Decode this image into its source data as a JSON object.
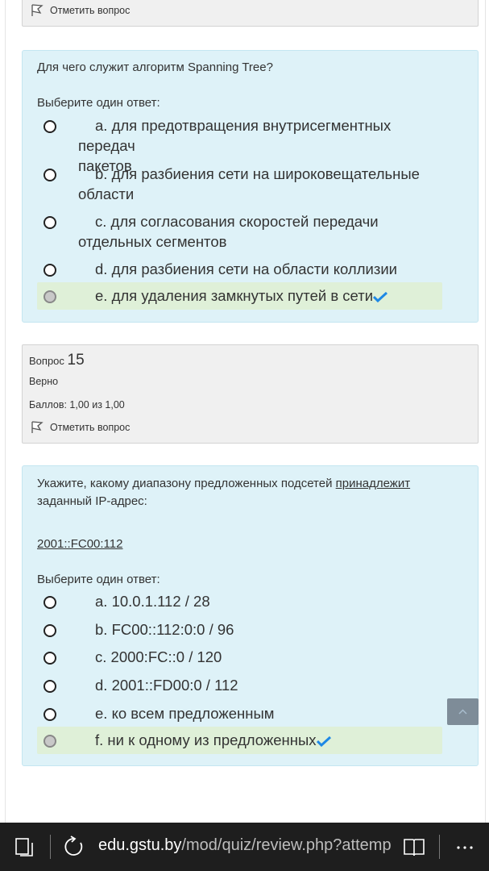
{
  "top_box": {
    "flag_label": "Отметить вопрос"
  },
  "question14": {
    "text": "Для чего служит алгоритм Spanning Tree?",
    "prompt": "Выберите один ответ:",
    "answers": [
      {
        "line1": "a. для предотвращения внутрисегментных передач",
        "line2": "пакетов"
      },
      {
        "line1": "b. для разбиения сети на широковещательные",
        "line2": "области"
      },
      {
        "line1": "c. для согласования скоростей передачи",
        "line2": "отдельных сегментов"
      },
      {
        "line1": "d. для разбиения сети на области коллизии"
      },
      {
        "line1": "e. для удаления замкнутых путей в сети",
        "correct": true
      }
    ]
  },
  "question15_info": {
    "label": "Вопрос",
    "number": "15",
    "status": "Верно",
    "score": "Баллов: 1,00 из 1,00",
    "flag_label": "Отметить вопрос"
  },
  "question15": {
    "text_before": "Укажите, какому диапазону предложенных подсетей ",
    "text_underlined": "принадлежит",
    "text_after": "заданный IP-адрес:",
    "ip": "2001::FC00:112",
    "prompt": "Выберите один ответ:",
    "answers": [
      {
        "line1": "a. 10.0.1.112 / 28"
      },
      {
        "line1": "b. FC00::112:0:0 / 96"
      },
      {
        "line1": "c. 2000:FC::0 / 120"
      },
      {
        "line1": "d. 2001::FD00:0 / 112"
      },
      {
        "line1": "e. ко всем предложенным"
      },
      {
        "line1": "f. ни к одному из предложенных",
        "correct": true
      }
    ]
  },
  "browser": {
    "url_domain": "edu.gstu.by",
    "url_path": "/mod/quiz/review.php?attempt="
  },
  "colors": {
    "content_bg": "#def2f8",
    "info_bg": "#f0f0f0",
    "correct_bg": "#dff0d8",
    "check": "#1e88e5",
    "taskbar": "#1e1e1e"
  }
}
